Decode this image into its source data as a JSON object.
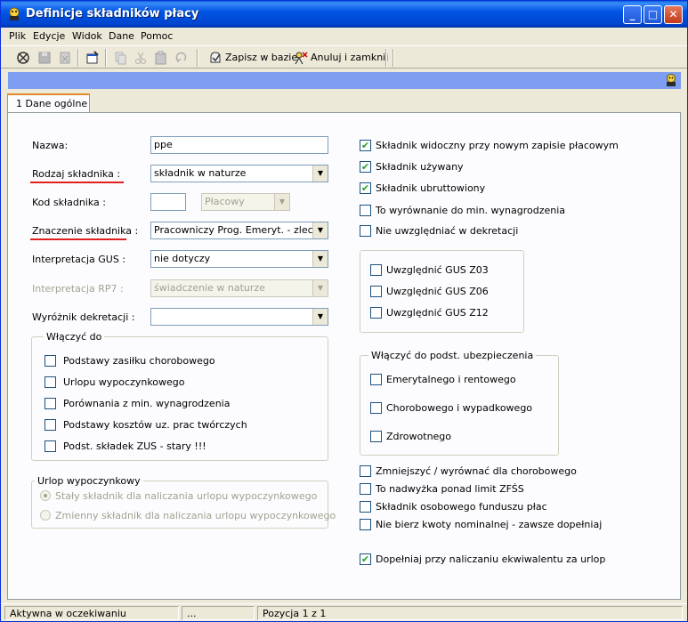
{
  "window": {
    "title": "Definicje składników płacy",
    "min": "_",
    "max": "□",
    "close": "✕"
  },
  "menu": [
    "Plik",
    "Edycje",
    "Widok",
    "Dane",
    "Pomoc"
  ],
  "toolbar": {
    "save_label": "Zapisz w bazie",
    "cancel_label": "Anuluj i zamknij"
  },
  "tabs": [
    {
      "label": "1 Dane ogólne"
    }
  ],
  "form": {
    "nazwa_label": "Nazwa:",
    "nazwa_value": "ppe",
    "rodzaj_label": "Rodzaj składnika :",
    "rodzaj_value": "składnik w naturze",
    "kod_label": "Kod składnika :",
    "kod_value": "",
    "kod_combo_value": "Płacowy",
    "znaczenie_label": "Znaczenie składnika :",
    "znaczenie_value": "Pracowniczy Prog. Emeryt. - zlec",
    "gus_label": "Interpretacja GUS :",
    "gus_value": "nie dotyczy",
    "rp7_label": "Interpretacja RP7 :",
    "rp7_value": "świadczenie w naturze",
    "wyroznik_label": "Wyróżnik dekretacji :",
    "wyroznik_value": ""
  },
  "wlaczyc_do": {
    "title": "Włączyć do",
    "items": [
      {
        "label": "Podstawy zasiłku chorobowego",
        "checked": false
      },
      {
        "label": "Urlopu wypoczynkowego",
        "checked": false
      },
      {
        "label": "Porównania z min. wynagrodzenia",
        "checked": false
      },
      {
        "label": "Podstawy kosztów uz. prac twórczych",
        "checked": false
      },
      {
        "label": "Podst. składek ZUS - stary !!!",
        "checked": false
      }
    ]
  },
  "urlop": {
    "title": "Urlop wypoczynkowy",
    "options": [
      {
        "label": "Stały składnik dla naliczania urlopu wypoczynkowego",
        "selected": true
      },
      {
        "label": "Zmienny składnik dla naliczania urlopu wypoczynkowego",
        "selected": false
      }
    ]
  },
  "right_checks_top": [
    {
      "label": "Składnik widoczny przy nowym zapisie płacowym",
      "checked": true
    },
    {
      "label": "Składnik używany",
      "checked": true
    },
    {
      "label": "Składnik ubruttowiony",
      "checked": true
    },
    {
      "label": "To wyrównanie do min. wynagrodzenia",
      "checked": false
    },
    {
      "label": "Nie uwzględniać w dekretacji",
      "checked": false
    }
  ],
  "gus_group": [
    {
      "label": "Uwzględnić GUS Z03",
      "checked": false
    },
    {
      "label": "Uwzględnić GUS Z06",
      "checked": false
    },
    {
      "label": "Uwzględnić GUS Z12",
      "checked": false
    }
  ],
  "ubezp": {
    "title": "Włączyć do podst. ubezpieczenia",
    "items": [
      {
        "label": "Emerytalnego i rentowego",
        "checked": false
      },
      {
        "label": "Chorobowego i wypadkowego",
        "checked": false
      },
      {
        "label": "Zdrowotnego",
        "checked": false
      }
    ]
  },
  "right_checks_bottom": [
    {
      "label": "Zmniejszyć / wyrównać dla chorobowego",
      "checked": false
    },
    {
      "label": "To nadwyżka ponad limit ZFŚS",
      "checked": false
    },
    {
      "label": "Składnik osobowego funduszu płac",
      "checked": false
    },
    {
      "label": "Nie bierz kwoty nominalnej - zawsze dopełniaj",
      "checked": false
    }
  ],
  "ekwiwalent": {
    "label": "Dopełniaj przy naliczaniu ekwiwalentu za urlop",
    "checked": true
  },
  "status": {
    "state": "Aktywna w oczekiwaniu",
    "dots": "...",
    "position": "Pozycja 1 z 1"
  },
  "check_mark": "✔",
  "combo_arrow": "▼"
}
